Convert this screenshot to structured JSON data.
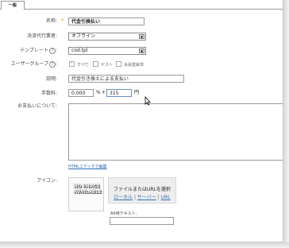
{
  "tabs": [
    {
      "label": "一般"
    }
  ],
  "form": {
    "name": {
      "label": "名称:",
      "required_mark": "*",
      "value": "代金引換払い"
    },
    "agent": {
      "label": "決済代行業者:",
      "selected": "オフライン"
    },
    "template": {
      "label": "テンプレート",
      "selected": "cod.tpl"
    },
    "user_groups": {
      "label": "ユーザーグループ",
      "options": [
        {
          "label": "すべて",
          "checked": true
        },
        {
          "label": "ゲスト",
          "checked": false
        },
        {
          "label": "会員登録済",
          "checked": false
        }
      ]
    },
    "description": {
      "label": "説明:",
      "value": "代金引き換えによる支払い"
    },
    "fee": {
      "label": "手数料:",
      "percent_value": "0.000",
      "percent_unit": "%",
      "plus": "+",
      "fixed_value": "315",
      "fixed_unit": "円"
    },
    "payment_notes": {
      "label": "お支払いについて:",
      "value": ""
    },
    "html_editor_link": "HTMLエディタで編集",
    "icon": {
      "label": "アイコン:",
      "placeholder_line1": "NO IMAGE",
      "placeholder_line2": "AVAILABLE",
      "file_prompt": "ファイルまたはURLを選択",
      "sources": [
        "ローカル",
        "サーバー",
        "URL"
      ],
      "separator": "|",
      "alt_label": "Alt用テキスト:",
      "alt_value": ""
    }
  },
  "colors": {
    "required": "#f08a00",
    "link": "#2a6db3"
  }
}
